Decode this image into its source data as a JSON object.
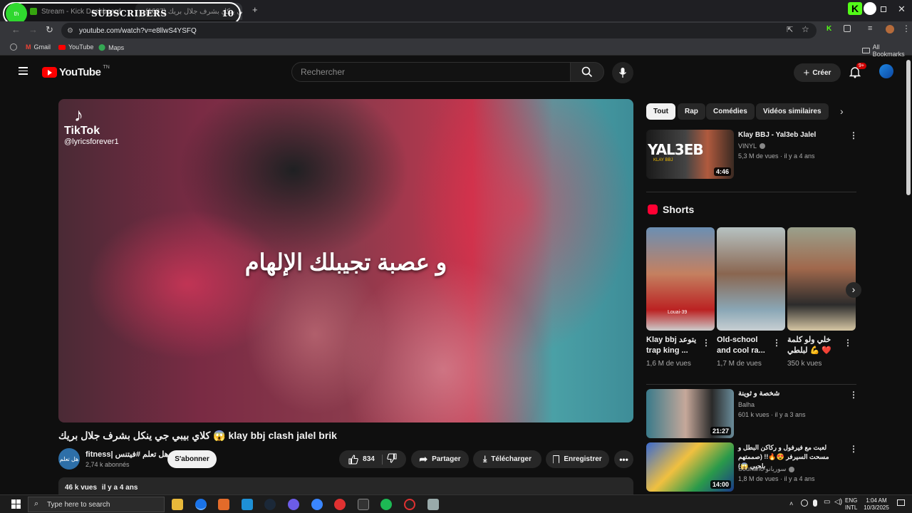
{
  "browser": {
    "tabs": [
      {
        "label": "Stream - Kick Dashboard",
        "active": false
      },
      {
        "label": "(1687) كلاي بيبي جي ينكل بشرف جلال بريك",
        "active": true
      }
    ],
    "new_tab_symbol": "+",
    "url": "youtube.com/watch?v=e8llwS4YSFQ",
    "bookmarks": [
      "Gmail",
      "YouTube",
      "Maps"
    ],
    "all_bookmarks": "All Bookmarks"
  },
  "overlay": {
    "label": "SUBSCRIBERS",
    "count": "10",
    "avatar_text": "th"
  },
  "youtube": {
    "logo": "YouTube",
    "logo_suffix": "TN",
    "search_placeholder": "Rechercher",
    "create_label": "Créer",
    "notif_badge": "9+"
  },
  "video": {
    "tiktok_brand": "TikTok",
    "tiktok_user": "@lyricsforever1",
    "lyric": "و عصبة تجيبلك الإلهام",
    "title": "كلاي بيبي جي ينكل بشرف جلال بريك 😱 klay bbj clash jalel brik",
    "channel_name": "fitness| هل تعلم #فيتنس",
    "channel_avatar_text": "هل تعلم",
    "subscribers": "2,74 k abonnés",
    "subscribe_label": "S'abonner",
    "likes": "834",
    "share_label": "Partager",
    "download_label": "Télécharger",
    "save_label": "Enregistrer",
    "views": "46 k vues",
    "date": "il y a 4 ans"
  },
  "sidebar": {
    "chips": [
      "Tout",
      "Rap",
      "Comédies",
      "Vidéos similaires"
    ],
    "first_video": {
      "title": "Klay BBJ - Yal3eb Jalel",
      "channel": "VINYL",
      "meta": "5,3 M de vues · il y a 4 ans",
      "duration": "4:46",
      "thumb_text": "YAL3EB",
      "thumb_sub": "KLAY BBJ"
    },
    "shorts_heading": "Shorts",
    "shorts": [
      {
        "title": "Klay bbj يتوعد trap king ...",
        "views": "1,6 M de vues",
        "overlay": "Louai-39"
      },
      {
        "title": "Old-school and cool ra...",
        "views": "1,7 M de vues",
        "overlay": ""
      },
      {
        "title": "خلي ولو كلمة لبلطي 💪 ❤️",
        "views": "350 k vues",
        "overlay": ""
      }
    ],
    "more_videos": [
      {
        "title": "شخصة و ثوينة",
        "channel": "Balha",
        "meta": "601 k vues · il y a 3 ans",
        "duration": "21:27"
      },
      {
        "title": "لعبت مع فيرفول و ركاكن البطل و مسحت السيرفر 😍🔥!! (صممتهم بلحيي 😱)",
        "channel": "Souriano سوريانو",
        "meta": "1,8 M de vues · il y a 4 ans",
        "duration": "14:00"
      }
    ]
  },
  "taskbar": {
    "search_placeholder": "Type here to search",
    "lang": "ENG",
    "lang2": "INTL",
    "time": "1:04 AM",
    "date": "10/3/2025"
  }
}
